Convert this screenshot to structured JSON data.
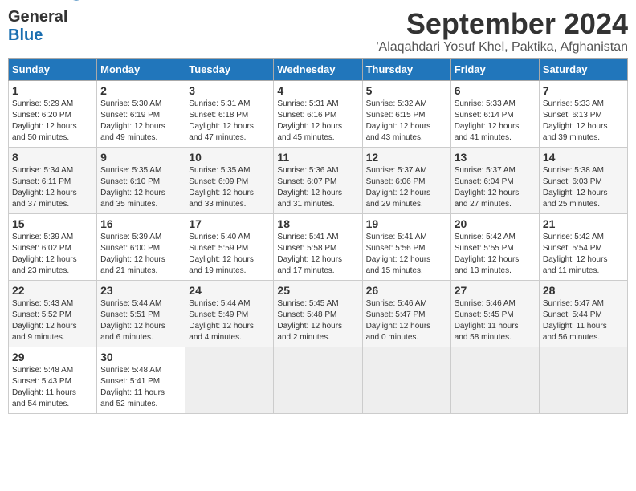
{
  "header": {
    "logo_general": "General",
    "logo_blue": "Blue",
    "month": "September 2024",
    "location": "'Alaqahdari Yosuf Khel, Paktika, Afghanistan"
  },
  "weekdays": [
    "Sunday",
    "Monday",
    "Tuesday",
    "Wednesday",
    "Thursday",
    "Friday",
    "Saturday"
  ],
  "weeks": [
    [
      {
        "day": "1",
        "info": "Sunrise: 5:29 AM\nSunset: 6:20 PM\nDaylight: 12 hours\nand 50 minutes."
      },
      {
        "day": "2",
        "info": "Sunrise: 5:30 AM\nSunset: 6:19 PM\nDaylight: 12 hours\nand 49 minutes."
      },
      {
        "day": "3",
        "info": "Sunrise: 5:31 AM\nSunset: 6:18 PM\nDaylight: 12 hours\nand 47 minutes."
      },
      {
        "day": "4",
        "info": "Sunrise: 5:31 AM\nSunset: 6:16 PM\nDaylight: 12 hours\nand 45 minutes."
      },
      {
        "day": "5",
        "info": "Sunrise: 5:32 AM\nSunset: 6:15 PM\nDaylight: 12 hours\nand 43 minutes."
      },
      {
        "day": "6",
        "info": "Sunrise: 5:33 AM\nSunset: 6:14 PM\nDaylight: 12 hours\nand 41 minutes."
      },
      {
        "day": "7",
        "info": "Sunrise: 5:33 AM\nSunset: 6:13 PM\nDaylight: 12 hours\nand 39 minutes."
      }
    ],
    [
      {
        "day": "8",
        "info": "Sunrise: 5:34 AM\nSunset: 6:11 PM\nDaylight: 12 hours\nand 37 minutes."
      },
      {
        "day": "9",
        "info": "Sunrise: 5:35 AM\nSunset: 6:10 PM\nDaylight: 12 hours\nand 35 minutes."
      },
      {
        "day": "10",
        "info": "Sunrise: 5:35 AM\nSunset: 6:09 PM\nDaylight: 12 hours\nand 33 minutes."
      },
      {
        "day": "11",
        "info": "Sunrise: 5:36 AM\nSunset: 6:07 PM\nDaylight: 12 hours\nand 31 minutes."
      },
      {
        "day": "12",
        "info": "Sunrise: 5:37 AM\nSunset: 6:06 PM\nDaylight: 12 hours\nand 29 minutes."
      },
      {
        "day": "13",
        "info": "Sunrise: 5:37 AM\nSunset: 6:04 PM\nDaylight: 12 hours\nand 27 minutes."
      },
      {
        "day": "14",
        "info": "Sunrise: 5:38 AM\nSunset: 6:03 PM\nDaylight: 12 hours\nand 25 minutes."
      }
    ],
    [
      {
        "day": "15",
        "info": "Sunrise: 5:39 AM\nSunset: 6:02 PM\nDaylight: 12 hours\nand 23 minutes."
      },
      {
        "day": "16",
        "info": "Sunrise: 5:39 AM\nSunset: 6:00 PM\nDaylight: 12 hours\nand 21 minutes."
      },
      {
        "day": "17",
        "info": "Sunrise: 5:40 AM\nSunset: 5:59 PM\nDaylight: 12 hours\nand 19 minutes."
      },
      {
        "day": "18",
        "info": "Sunrise: 5:41 AM\nSunset: 5:58 PM\nDaylight: 12 hours\nand 17 minutes."
      },
      {
        "day": "19",
        "info": "Sunrise: 5:41 AM\nSunset: 5:56 PM\nDaylight: 12 hours\nand 15 minutes."
      },
      {
        "day": "20",
        "info": "Sunrise: 5:42 AM\nSunset: 5:55 PM\nDaylight: 12 hours\nand 13 minutes."
      },
      {
        "day": "21",
        "info": "Sunrise: 5:42 AM\nSunset: 5:54 PM\nDaylight: 12 hours\nand 11 minutes."
      }
    ],
    [
      {
        "day": "22",
        "info": "Sunrise: 5:43 AM\nSunset: 5:52 PM\nDaylight: 12 hours\nand 9 minutes."
      },
      {
        "day": "23",
        "info": "Sunrise: 5:44 AM\nSunset: 5:51 PM\nDaylight: 12 hours\nand 6 minutes."
      },
      {
        "day": "24",
        "info": "Sunrise: 5:44 AM\nSunset: 5:49 PM\nDaylight: 12 hours\nand 4 minutes."
      },
      {
        "day": "25",
        "info": "Sunrise: 5:45 AM\nSunset: 5:48 PM\nDaylight: 12 hours\nand 2 minutes."
      },
      {
        "day": "26",
        "info": "Sunrise: 5:46 AM\nSunset: 5:47 PM\nDaylight: 12 hours\nand 0 minutes."
      },
      {
        "day": "27",
        "info": "Sunrise: 5:46 AM\nSunset: 5:45 PM\nDaylight: 11 hours\nand 58 minutes."
      },
      {
        "day": "28",
        "info": "Sunrise: 5:47 AM\nSunset: 5:44 PM\nDaylight: 11 hours\nand 56 minutes."
      }
    ],
    [
      {
        "day": "29",
        "info": "Sunrise: 5:48 AM\nSunset: 5:43 PM\nDaylight: 11 hours\nand 54 minutes."
      },
      {
        "day": "30",
        "info": "Sunrise: 5:48 AM\nSunset: 5:41 PM\nDaylight: 11 hours\nand 52 minutes."
      },
      {
        "day": "",
        "info": ""
      },
      {
        "day": "",
        "info": ""
      },
      {
        "day": "",
        "info": ""
      },
      {
        "day": "",
        "info": ""
      },
      {
        "day": "",
        "info": ""
      }
    ]
  ]
}
